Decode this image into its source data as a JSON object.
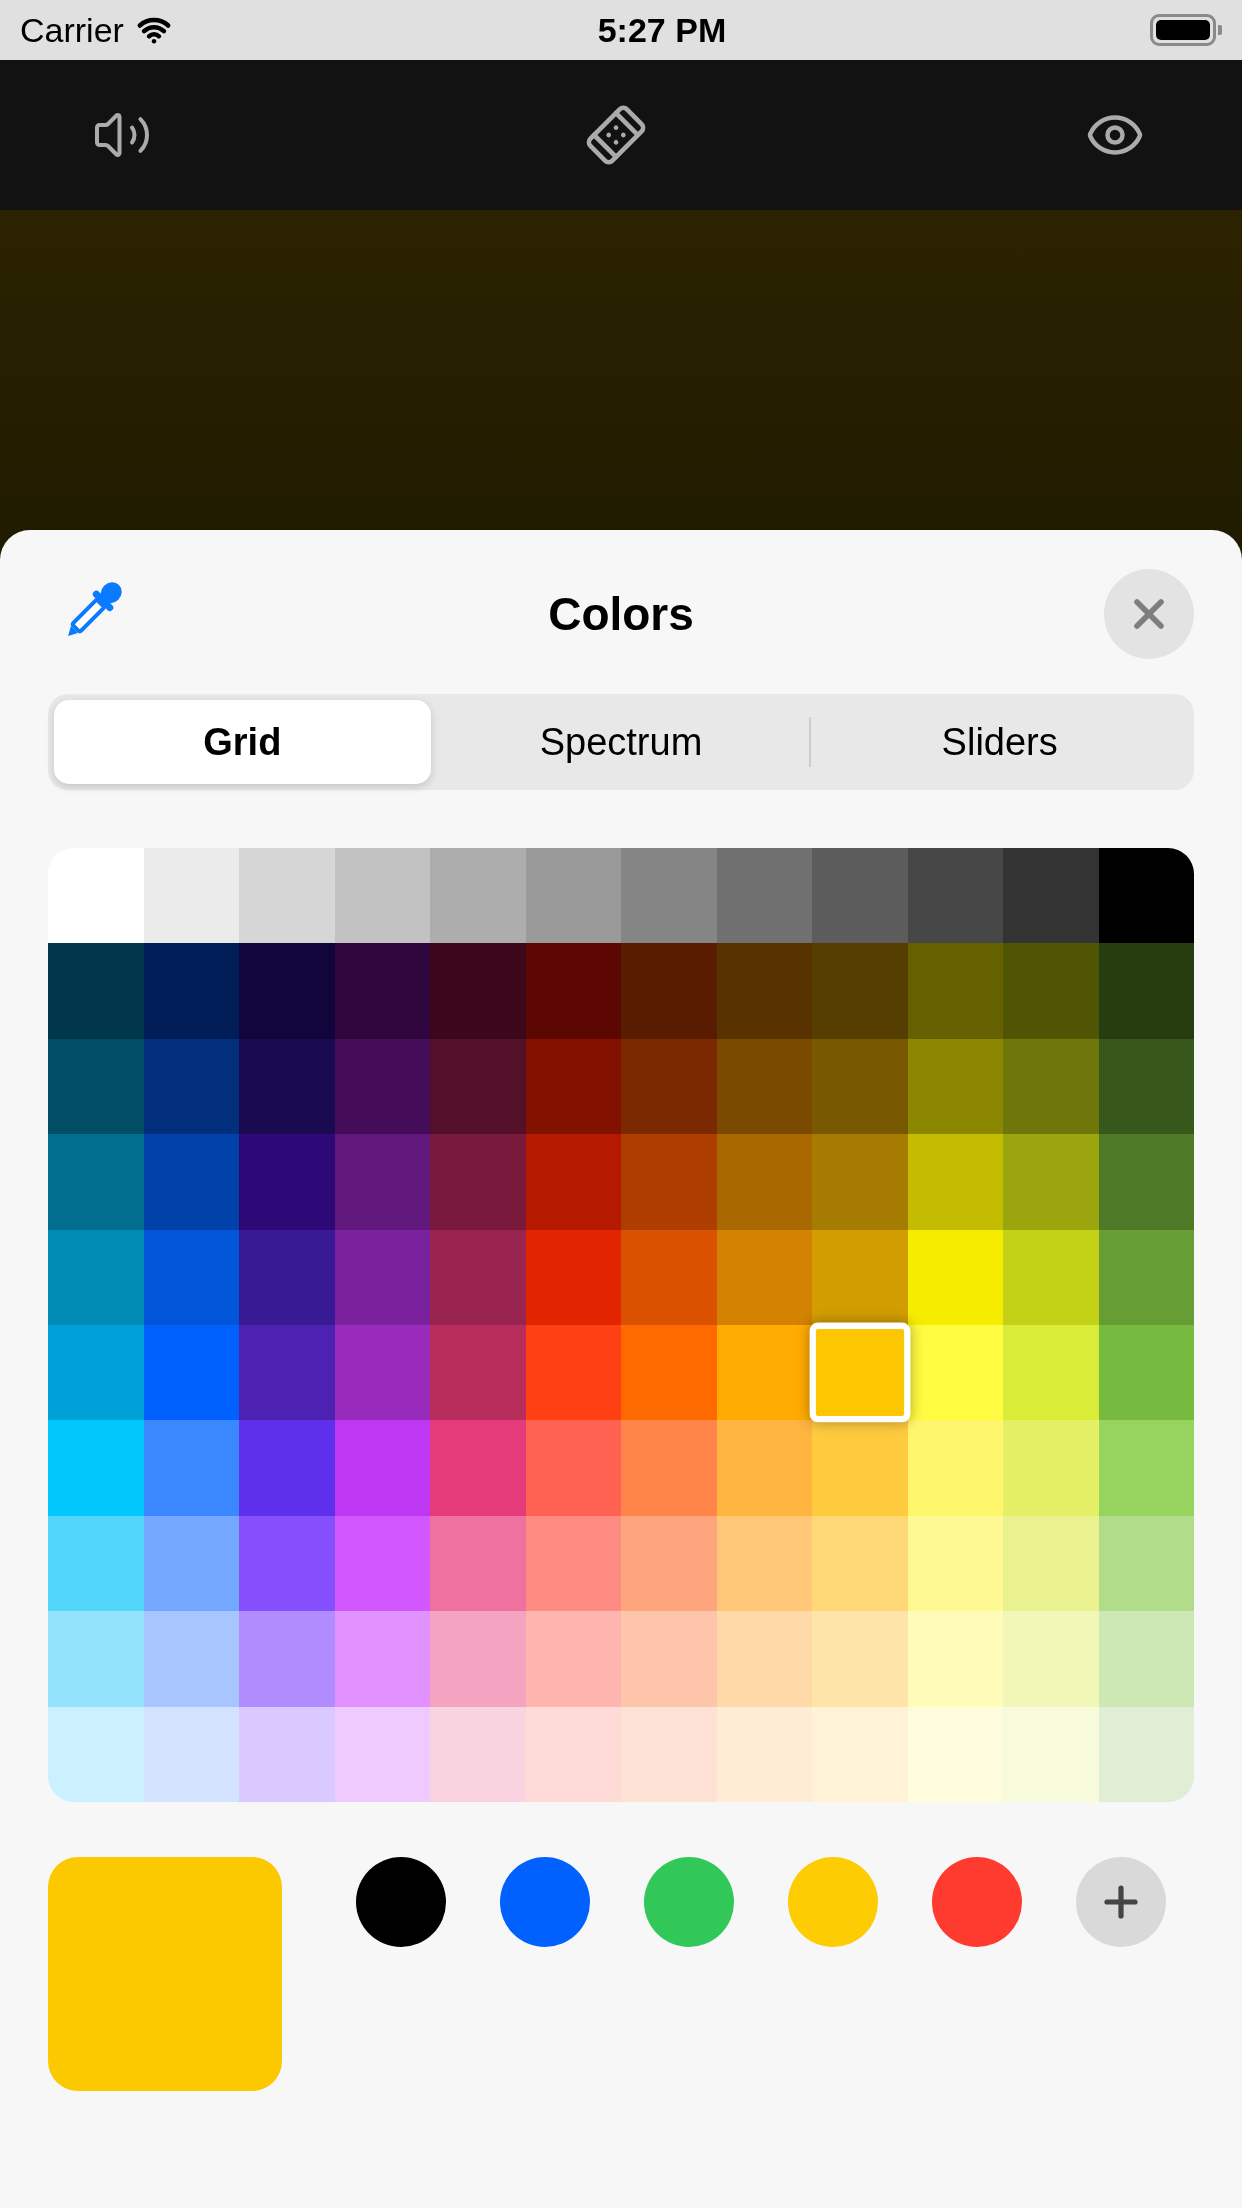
{
  "status_bar": {
    "carrier": "Carrier",
    "time": "5:27 PM"
  },
  "sheet": {
    "title": "Colors"
  },
  "tabs": [
    {
      "label": "Grid",
      "selected": true
    },
    {
      "label": "Spectrum",
      "selected": false
    },
    {
      "label": "Sliders",
      "selected": false
    }
  ],
  "grid": {
    "rows": [
      [
        {
          "color": "#ffffff",
          "selected": false
        },
        {
          "color": "#ebebeb",
          "selected": false
        },
        {
          "color": "#d6d6d6",
          "selected": false
        },
        {
          "color": "#c2c2c2",
          "selected": false
        },
        {
          "color": "#adadad",
          "selected": false
        },
        {
          "color": "#999999",
          "selected": false
        },
        {
          "color": "#858585",
          "selected": false
        },
        {
          "color": "#707070",
          "selected": false
        },
        {
          "color": "#5c5c5c",
          "selected": false
        },
        {
          "color": "#474747",
          "selected": false
        },
        {
          "color": "#333333",
          "selected": false
        },
        {
          "color": "#000000",
          "selected": false
        }
      ],
      [
        {
          "color": "#00374a",
          "selected": false
        },
        {
          "color": "#011d57",
          "selected": false
        },
        {
          "color": "#11053b",
          "selected": false
        },
        {
          "color": "#2e063d",
          "selected": false
        },
        {
          "color": "#3c071b",
          "selected": false
        },
        {
          "color": "#5c0701",
          "selected": false
        },
        {
          "color": "#5a1c00",
          "selected": false
        },
        {
          "color": "#583300",
          "selected": false
        },
        {
          "color": "#563d00",
          "selected": false
        },
        {
          "color": "#666100",
          "selected": false
        },
        {
          "color": "#4f5504",
          "selected": false
        },
        {
          "color": "#263e0f",
          "selected": false
        }
      ],
      [
        {
          "color": "#004d65",
          "selected": false
        },
        {
          "color": "#012f7b",
          "selected": false
        },
        {
          "color": "#1a0a52",
          "selected": false
        },
        {
          "color": "#450d59",
          "selected": false
        },
        {
          "color": "#551029",
          "selected": false
        },
        {
          "color": "#831100",
          "selected": false
        },
        {
          "color": "#7b2900",
          "selected": false
        },
        {
          "color": "#7a4a00",
          "selected": false
        },
        {
          "color": "#785800",
          "selected": false
        },
        {
          "color": "#8c8700",
          "selected": false
        },
        {
          "color": "#6f760a",
          "selected": false
        },
        {
          "color": "#38571a",
          "selected": false
        }
      ],
      [
        {
          "color": "#016e8f",
          "selected": false
        },
        {
          "color": "#0042a9",
          "selected": false
        },
        {
          "color": "#2c0977",
          "selected": false
        },
        {
          "color": "#61187c",
          "selected": false
        },
        {
          "color": "#791a3d",
          "selected": false
        },
        {
          "color": "#b51a00",
          "selected": false
        },
        {
          "color": "#ad3e00",
          "selected": false
        },
        {
          "color": "#a96800",
          "selected": false
        },
        {
          "color": "#a67b01",
          "selected": false
        },
        {
          "color": "#c4bc00",
          "selected": false
        },
        {
          "color": "#9ba50e",
          "selected": false
        },
        {
          "color": "#4e7a27",
          "selected": false
        }
      ],
      [
        {
          "color": "#008cb4",
          "selected": false
        },
        {
          "color": "#0056d6",
          "selected": false
        },
        {
          "color": "#371a94",
          "selected": false
        },
        {
          "color": "#7a219e",
          "selected": false
        },
        {
          "color": "#99244f",
          "selected": false
        },
        {
          "color": "#e22400",
          "selected": false
        },
        {
          "color": "#da5100",
          "selected": false
        },
        {
          "color": "#d38301",
          "selected": false
        },
        {
          "color": "#d19d01",
          "selected": false
        },
        {
          "color": "#f5ec00",
          "selected": false
        },
        {
          "color": "#c3d117",
          "selected": false
        },
        {
          "color": "#669d34",
          "selected": false
        }
      ],
      [
        {
          "color": "#00a1d8",
          "selected": false
        },
        {
          "color": "#0061fe",
          "selected": false
        },
        {
          "color": "#4d22b2",
          "selected": false
        },
        {
          "color": "#982abc",
          "selected": false
        },
        {
          "color": "#b92d5d",
          "selected": false
        },
        {
          "color": "#ff4015",
          "selected": false
        },
        {
          "color": "#ff6a00",
          "selected": false
        },
        {
          "color": "#ffab01",
          "selected": false
        },
        {
          "color": "#fcc700",
          "selected": true
        },
        {
          "color": "#fefb41",
          "selected": false
        },
        {
          "color": "#d9ec37",
          "selected": false
        },
        {
          "color": "#76bb40",
          "selected": false
        }
      ],
      [
        {
          "color": "#01c7fc",
          "selected": false
        },
        {
          "color": "#3a87fe",
          "selected": false
        },
        {
          "color": "#5e30eb",
          "selected": false
        },
        {
          "color": "#be38f3",
          "selected": false
        },
        {
          "color": "#e63b7a",
          "selected": false
        },
        {
          "color": "#ff6250",
          "selected": false
        },
        {
          "color": "#ff8648",
          "selected": false
        },
        {
          "color": "#feb43f",
          "selected": false
        },
        {
          "color": "#fecb3e",
          "selected": false
        },
        {
          "color": "#fff76b",
          "selected": false
        },
        {
          "color": "#e4ef65",
          "selected": false
        },
        {
          "color": "#96d35f",
          "selected": false
        }
      ],
      [
        {
          "color": "#52d6fc",
          "selected": false
        },
        {
          "color": "#74a7ff",
          "selected": false
        },
        {
          "color": "#864ffe",
          "selected": false
        },
        {
          "color": "#d357fe",
          "selected": false
        },
        {
          "color": "#ee719e",
          "selected": false
        },
        {
          "color": "#ff8c82",
          "selected": false
        },
        {
          "color": "#ffa57d",
          "selected": false
        },
        {
          "color": "#ffc777",
          "selected": false
        },
        {
          "color": "#fed877",
          "selected": false
        },
        {
          "color": "#fff994",
          "selected": false
        },
        {
          "color": "#eaf28f",
          "selected": false
        },
        {
          "color": "#b1dd8b",
          "selected": false
        }
      ],
      [
        {
          "color": "#93e3fc",
          "selected": false
        },
        {
          "color": "#a7c6ff",
          "selected": false
        },
        {
          "color": "#b18cfe",
          "selected": false
        },
        {
          "color": "#e292fe",
          "selected": false
        },
        {
          "color": "#f4a4c0",
          "selected": false
        },
        {
          "color": "#ffb5af",
          "selected": false
        },
        {
          "color": "#ffc5ab",
          "selected": false
        },
        {
          "color": "#ffd9a8",
          "selected": false
        },
        {
          "color": "#fee4a8",
          "selected": false
        },
        {
          "color": "#fffbb9",
          "selected": false
        },
        {
          "color": "#f2f7b7",
          "selected": false
        },
        {
          "color": "#cde8b5",
          "selected": false
        }
      ],
      [
        {
          "color": "#cbf0ff",
          "selected": false
        },
        {
          "color": "#d3e2ff",
          "selected": false
        },
        {
          "color": "#d9c9fe",
          "selected": false
        },
        {
          "color": "#efcaff",
          "selected": false
        },
        {
          "color": "#f9d3e0",
          "selected": false
        },
        {
          "color": "#ffdbd8",
          "selected": false
        },
        {
          "color": "#ffe2d6",
          "selected": false
        },
        {
          "color": "#ffecd4",
          "selected": false
        },
        {
          "color": "#fff2d5",
          "selected": false
        },
        {
          "color": "#fefcdd",
          "selected": false
        },
        {
          "color": "#f7fadb",
          "selected": false
        },
        {
          "color": "#dfeed4",
          "selected": false
        }
      ]
    ]
  },
  "current_color": {
    "color": "#fcc800"
  },
  "favorites": [
    {
      "color": "#000000"
    },
    {
      "color": "#0061fe"
    },
    {
      "color": "#31c759"
    },
    {
      "color": "#fecc02"
    },
    {
      "color": "#ff3b30"
    }
  ]
}
